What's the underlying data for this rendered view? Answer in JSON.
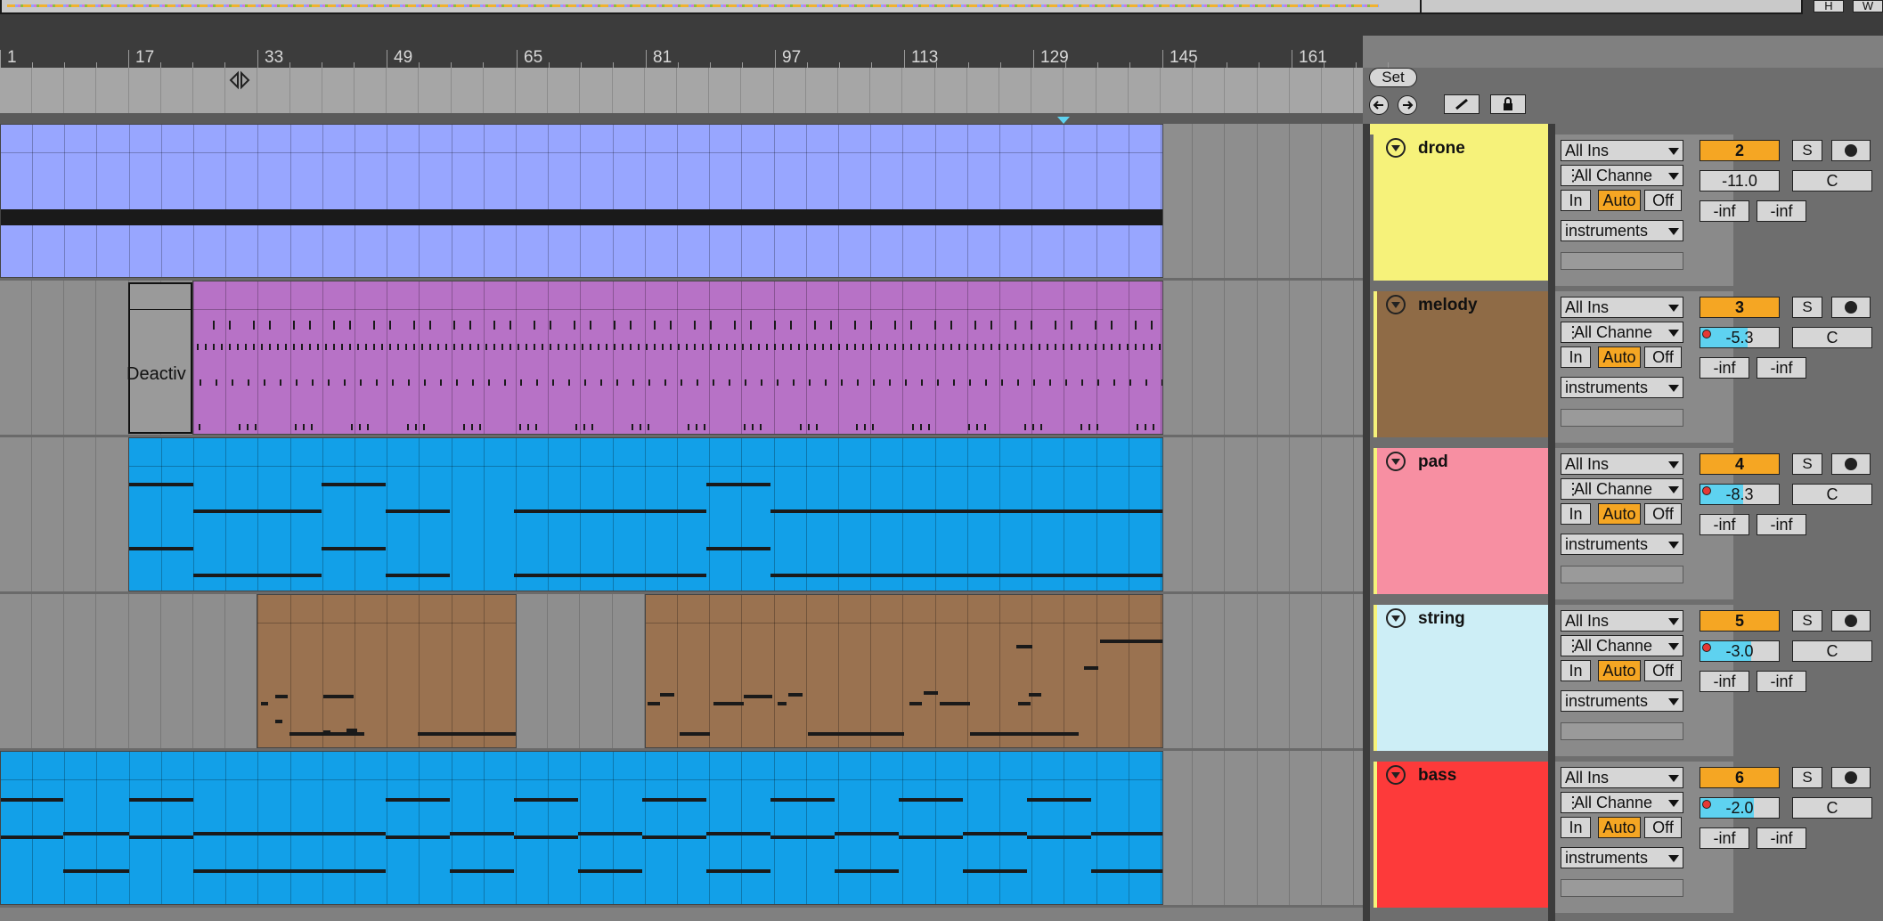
{
  "topbar": {
    "btn_h": "H",
    "btn_w": "W"
  },
  "ruler": {
    "labels": [
      "1",
      "17",
      "33",
      "49",
      "65",
      "81",
      "97",
      "113",
      "129",
      "145",
      "161"
    ]
  },
  "controls": {
    "set_label": "Set"
  },
  "clips": {
    "deactivated_label": "Deactiv"
  },
  "tracks": [
    {
      "name": "drone",
      "color": "#f6f27a",
      "input_type": "All Ins",
      "input_channel": "All Channe",
      "monitor": [
        "In",
        "Auto",
        "Off"
      ],
      "output": "instruments",
      "number": "2",
      "solo": "S",
      "volume": "-11.0",
      "volume_fraction": 0.0,
      "pan": "C",
      "meter_left": "-inf",
      "meter_right": "-inf"
    },
    {
      "name": "melody",
      "color": "#8f6b46",
      "input_type": "All Ins",
      "input_channel": "All Channe",
      "monitor": [
        "In",
        "Auto",
        "Off"
      ],
      "output": "instruments",
      "number": "3",
      "solo": "S",
      "volume": "-5.3",
      "volume_fraction": 0.6,
      "pan": "C",
      "meter_left": "-inf",
      "meter_right": "-inf"
    },
    {
      "name": "pad",
      "color": "#f78fa2",
      "input_type": "All Ins",
      "input_channel": "All Channe",
      "monitor": [
        "In",
        "Auto",
        "Off"
      ],
      "output": "instruments",
      "number": "4",
      "solo": "S",
      "volume": "-8.3",
      "volume_fraction": 0.55,
      "pan": "C",
      "meter_left": "-inf",
      "meter_right": "-inf"
    },
    {
      "name": "string",
      "color": "#cdeef6",
      "input_type": "All Ins",
      "input_channel": "All Channe",
      "monitor": [
        "In",
        "Auto",
        "Off"
      ],
      "output": "instruments",
      "number": "5",
      "solo": "S",
      "volume": "-3.0",
      "volume_fraction": 0.65,
      "pan": "C",
      "meter_left": "-inf",
      "meter_right": "-inf"
    },
    {
      "name": "bass",
      "color": "#fd3a3a",
      "input_type": "All Ins",
      "input_channel": "All Channe",
      "monitor": [
        "In",
        "Auto",
        "Off"
      ],
      "output": "instruments",
      "number": "6",
      "solo": "S",
      "volume": "-2.0",
      "volume_fraction": 0.68,
      "pan": "C",
      "meter_left": "-inf",
      "meter_right": "-inf"
    }
  ]
}
